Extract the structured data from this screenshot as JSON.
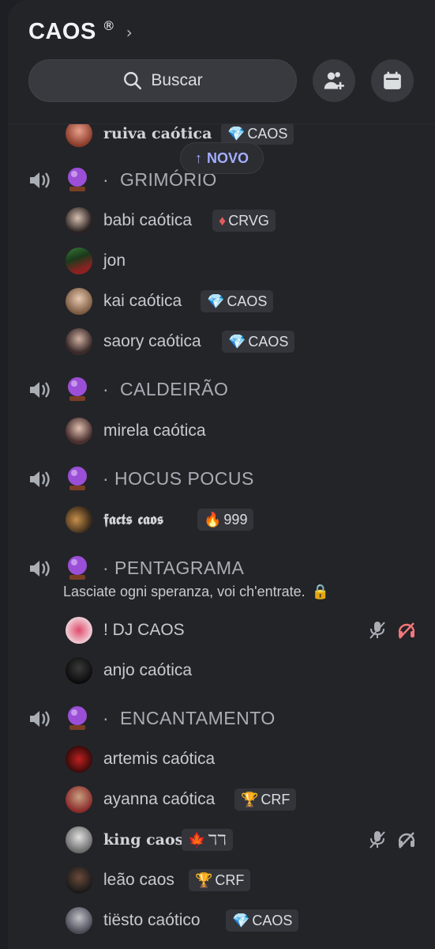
{
  "header": {
    "server_name": "CAOS",
    "registered_mark": "®",
    "chevron": "chevron-right-icon",
    "search_label": "Buscar",
    "buttons": [
      "invite-members-icon",
      "events-calendar-icon"
    ]
  },
  "new_pill": {
    "arrow": "↑",
    "label": "NOVO"
  },
  "top_partial_member": {
    "name": "ruiva caótica",
    "tag": {
      "icon": "💎",
      "text": "CAOS"
    }
  },
  "channels": [
    {
      "name": "·  GRIMÓRIO",
      "members": [
        {
          "name": "babi caótica",
          "tag": {
            "icon": "♦",
            "text": "CRVG"
          }
        },
        {
          "name": "jon",
          "tag": null
        },
        {
          "name": "kai caótica",
          "tag": {
            "icon": "💎",
            "text": "CAOS"
          }
        },
        {
          "name": "saory caótica",
          "tag": {
            "icon": "💎",
            "text": "CAOS"
          }
        }
      ]
    },
    {
      "name": "·  CALDEIRÃO",
      "members": [
        {
          "name": "mirela caótica",
          "tag": null
        }
      ]
    },
    {
      "name": "· HOCUS POCUS",
      "members": [
        {
          "name": "𝖋𝖆𝖈𝖙𝖘 𝖈𝖆𝖔𝖘",
          "tag": {
            "icon": "🔥",
            "text": "999"
          }
        }
      ]
    },
    {
      "name": "· PENTAGRAMA",
      "topic": "Lasciate ogni speranza, voi ch'entrate.",
      "topic_icon": "🔒",
      "members": [
        {
          "name": "! DJ CAOS",
          "tag": null,
          "status": [
            "muted-mic-icon",
            "deafened-headphones-icon"
          ]
        },
        {
          "name": "anjo caótica",
          "tag": null
        }
      ]
    },
    {
      "name": "·  ENCANTAMENTO",
      "members": [
        {
          "name": "artemis caótica",
          "tag": null
        },
        {
          "name": "ayanna caótica",
          "tag": {
            "icon": "🏆",
            "text": "CRF"
          }
        },
        {
          "name": "𝐤𝐢𝐧𝐠 𝐜𝐚𝐨𝐬",
          "tag": {
            "icon": "🍁",
            "text": "ℸℸ"
          },
          "status": [
            "mic-off-icon",
            "headphones-off-icon"
          ]
        },
        {
          "name": "leão caos",
          "tag": {
            "icon": "🏆",
            "text": "CRF"
          }
        },
        {
          "name": "tiësto caótico",
          "tag": {
            "icon": "💎",
            "text": "CAOS"
          }
        }
      ]
    }
  ],
  "colors": {
    "background": "#232428",
    "accent": "#a4adff",
    "deafened": "#f2777a"
  }
}
